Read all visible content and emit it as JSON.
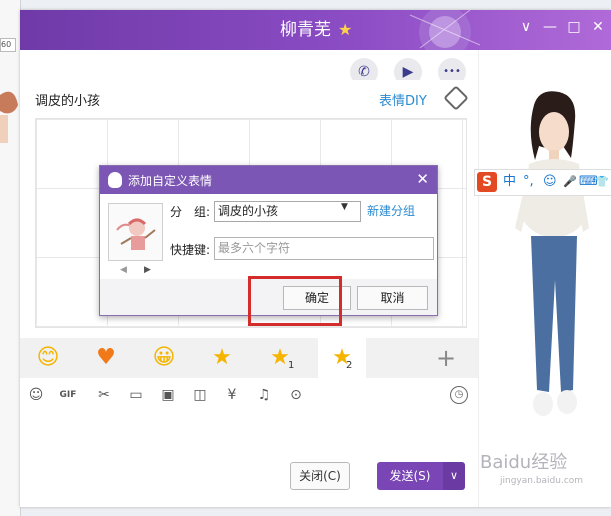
{
  "bg_window": {
    "ruler_text": "60"
  },
  "title": {
    "name": "柳青芜",
    "star": "★"
  },
  "window_controls": [
    "∨",
    "—",
    "□",
    "✕"
  ],
  "top_actions": [
    {
      "icon": "phone-icon",
      "glyph": "✆"
    },
    {
      "icon": "video-icon",
      "glyph": "▶"
    },
    {
      "icon": "more-icon",
      "glyph": "•••"
    }
  ],
  "chat": {
    "contact": "调皮的小孩",
    "emoji_diy": "表情DIY"
  },
  "emoji_tabs": [
    {
      "glyph": "😊",
      "name": "smile"
    },
    {
      "glyph": "♥",
      "name": "heart"
    },
    {
      "glyph": "😀",
      "name": "grin"
    },
    {
      "glyph": "★",
      "name": "star"
    },
    {
      "glyph": "★",
      "num": "1",
      "name": "star-1"
    },
    {
      "glyph": "★",
      "num": "2",
      "name": "star-2"
    }
  ],
  "add_tab": "+",
  "toolbar_tools": [
    "☺",
    "GIF",
    "✂",
    "▭",
    "▣",
    "◫",
    "¥",
    "♫",
    "⊙"
  ],
  "history_icon": "◷",
  "buttons": {
    "close": "关闭(C)",
    "send": "发送(S)",
    "send_arrow": "∨"
  },
  "dialog": {
    "title": "添加自定义表情",
    "close": "✕",
    "group_label": "分　组:",
    "group_value": "调皮的小孩",
    "new_group": "新建分组",
    "shortcut_label": "快捷键:",
    "shortcut_placeholder": "最多六个字符",
    "nav_prev": "◀",
    "nav_next": "▶",
    "ok": "确定",
    "cancel": "取消"
  },
  "ime": {
    "logo": "S",
    "items": [
      "中",
      "°,",
      "☺",
      "🎤",
      "⌨",
      "👕"
    ]
  },
  "watermark": {
    "main": "Baidu经验",
    "sub": "jingyan.baidu.com"
  },
  "colors": {
    "title_bar": "#7c45b8",
    "send": "#7a45b4",
    "link": "#2a8bd1",
    "highlight": "#d42b2b"
  }
}
